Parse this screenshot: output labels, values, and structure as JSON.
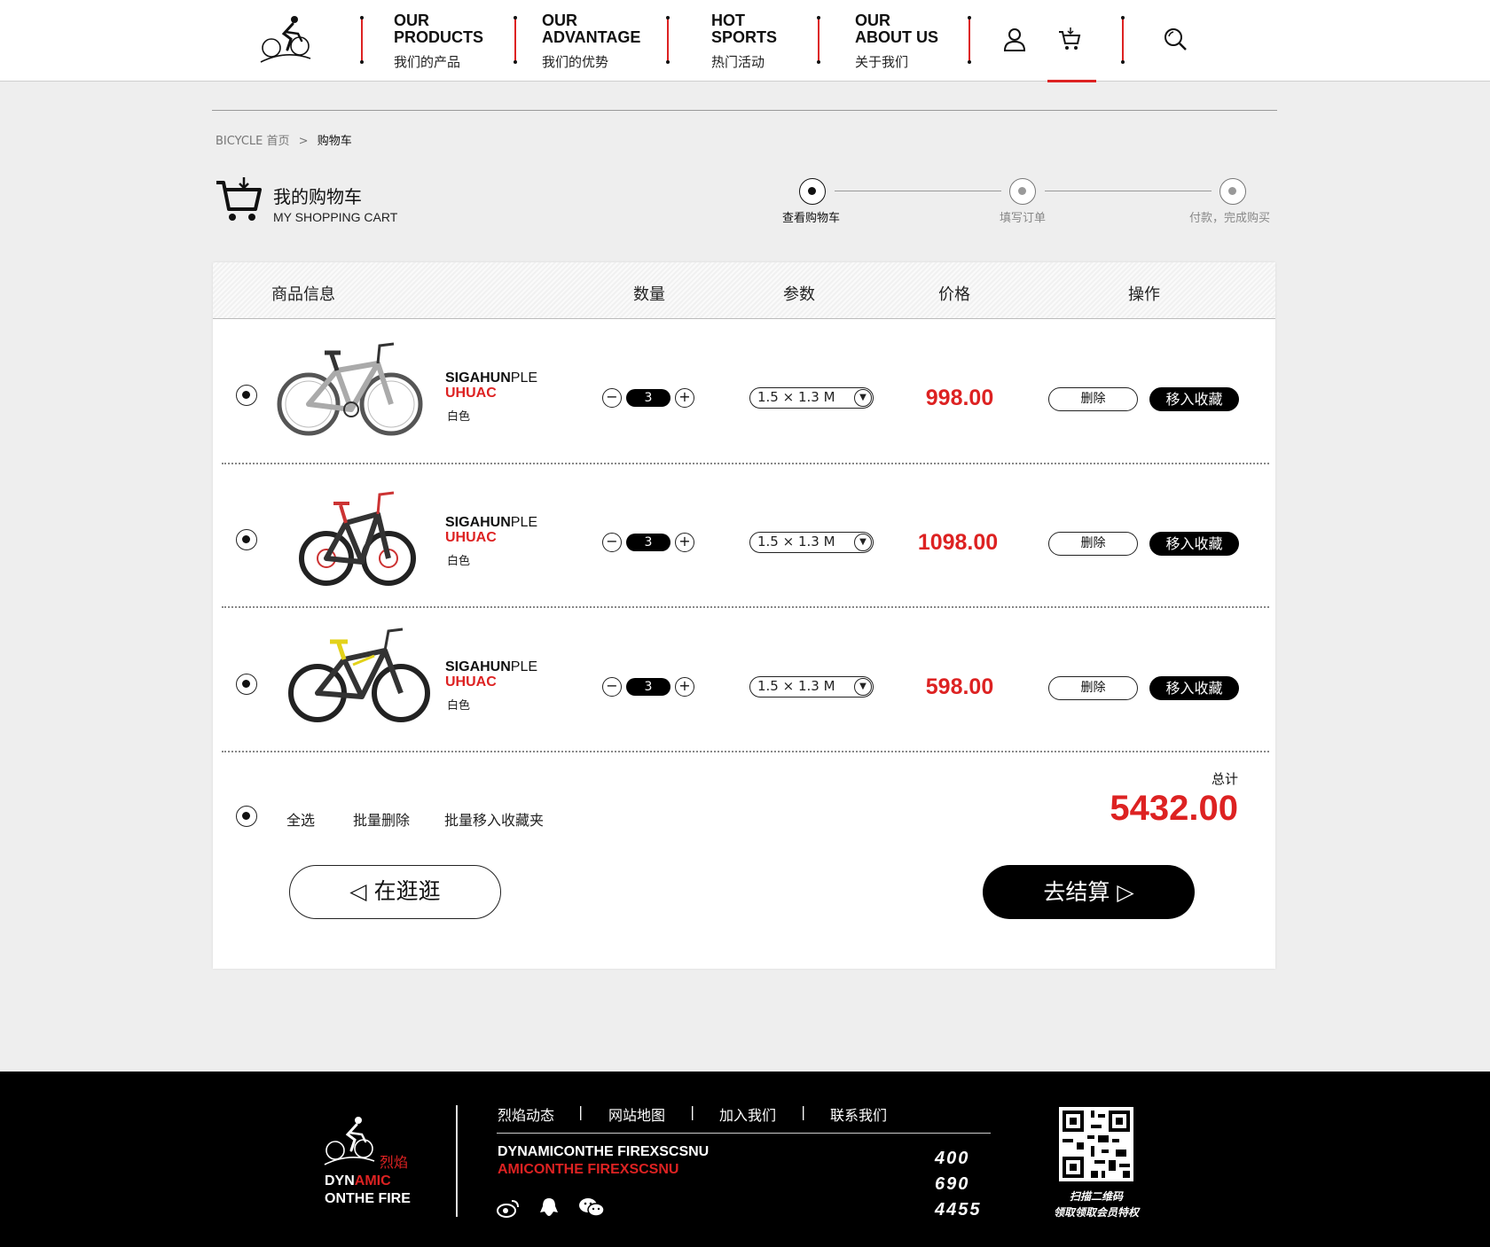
{
  "nav": {
    "items": [
      {
        "en": "OUR\nPRODUCTS",
        "cn": "我们的产品"
      },
      {
        "en": "OUR\nADVANTAGE",
        "cn": "我们的优势"
      },
      {
        "en": "HOT\nSPORTS",
        "cn": "热门活动"
      },
      {
        "en": "OUR\nABOUT US",
        "cn": "关于我们"
      }
    ],
    "icons": [
      "user-icon",
      "cart-icon",
      "search-icon"
    ],
    "active": "cart-icon"
  },
  "breadcrumb": {
    "home": "BICYCLE 首页",
    "separator": ">",
    "current": "购物车"
  },
  "cart_header": {
    "title_cn": "我的购物车",
    "title_en": "MY SHOPPING CART"
  },
  "steps": [
    {
      "label": "查看购物车",
      "active": true
    },
    {
      "label": "填写订单",
      "active": false
    },
    {
      "label": "付款，完成购买",
      "active": false
    }
  ],
  "table": {
    "columns": [
      "商品信息",
      "数量",
      "参数",
      "价格",
      "操作"
    ],
    "rows": [
      {
        "name_bold": "SIGAHUN",
        "name_rest": "PLE",
        "name_red": "UHUAC",
        "color": "白色",
        "qty": "3",
        "spec": "1.5 × 1.3  M",
        "price": "998.00",
        "delete": "删除",
        "favorite": "移入收藏",
        "selected": true
      },
      {
        "name_bold": "SIGAHUN",
        "name_rest": "PLE",
        "name_red": "UHUAC",
        "color": "白色",
        "qty": "3",
        "spec": "1.5 × 1.3  M",
        "price": "1098.00",
        "delete": "删除",
        "favorite": "移入收藏",
        "selected": true
      },
      {
        "name_bold": "SIGAHUN",
        "name_rest": "PLE",
        "name_red": "UHUAC",
        "color": "白色",
        "qty": "3",
        "spec": "1.5 × 1.3  M",
        "price": "598.00",
        "delete": "删除",
        "favorite": "移入收藏",
        "selected": true
      }
    ],
    "qty_minus": "−",
    "qty_plus": "+",
    "spec_arrow": "▼"
  },
  "bulk": {
    "select_all": "全选",
    "batch_delete": "批量删除",
    "batch_favorite": "批量移入收藏夹"
  },
  "total": {
    "label": "总计",
    "value": "5432.00"
  },
  "buttons": {
    "back": "◁  在逛逛",
    "checkout": "去结算  ▷"
  },
  "footer": {
    "links": [
      "烈焰动态",
      "网站地图",
      "加入我们",
      "联系我们"
    ],
    "pipe": "|",
    "line1": "DYNAMICONTHE FIREXSCSNU",
    "line2": "AMICONTHE FIREXSCSNU",
    "phone": [
      "400",
      "690",
      "4455"
    ],
    "brand_cn": "烈焰",
    "brand_a": "DYN",
    "brand_b": "AMIC",
    "brand_c": "ONTHE FIRE",
    "social_icons": [
      "weibo-icon",
      "qq-icon",
      "wechat-icon"
    ],
    "qr_caption1": "扫描二维码",
    "qr_caption2": "领取领取会员特权"
  },
  "colors": {
    "accent": "#dd2222",
    "dark": "#000000",
    "bg": "#eeeeee"
  }
}
